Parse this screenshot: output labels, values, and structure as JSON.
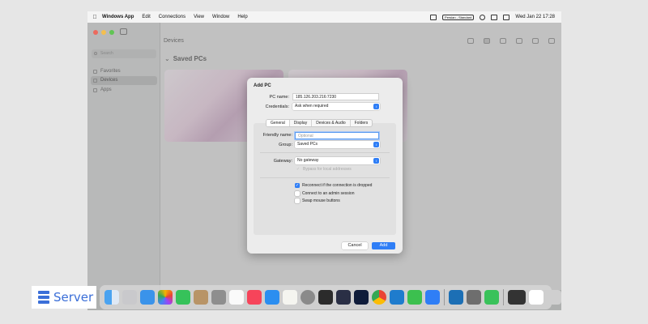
{
  "menubar": {
    "app_name": "Windows App",
    "items": [
      "Edit",
      "Connections",
      "View",
      "Window",
      "Help"
    ],
    "status_label": "Persian - Standard",
    "datetime": "Wed Jan 22  17:28"
  },
  "sidebar": {
    "search_placeholder": "Search",
    "items": [
      {
        "label": "Favorites",
        "icon": "star-icon"
      },
      {
        "label": "Devices",
        "icon": "monitor-icon"
      },
      {
        "label": "Apps",
        "icon": "apps-icon"
      }
    ]
  },
  "main": {
    "title": "Devices",
    "group_title": "Saved PCs"
  },
  "dialog": {
    "title": "Add PC",
    "pc_name_label": "PC name:",
    "pc_name_value": "185.126.203.216:7230",
    "credentials_label": "Credentials:",
    "credentials_value": "Ask when required",
    "tabs": [
      "General",
      "Display",
      "Devices & Audio",
      "Folders"
    ],
    "friendly_name_label": "Friendly name:",
    "friendly_name_placeholder": "Optional",
    "group_label": "Group:",
    "group_value": "Saved PCs",
    "gateway_label": "Gateway:",
    "gateway_value": "No gateway",
    "bypass_label": "Bypass for local addresses",
    "options": [
      {
        "label": "Reconnect if the connection is dropped",
        "checked": true
      },
      {
        "label": "Connect to an admin session",
        "checked": false
      },
      {
        "label": "Swap mouse buttons",
        "checked": false
      }
    ],
    "cancel_label": "Cancel",
    "add_label": "Add"
  },
  "colors": {
    "accent": "#2f7ef6",
    "logo": "#3b6fd8"
  },
  "dock_apps": [
    "finder",
    "launchpad",
    "safari",
    "photos",
    "facetime",
    "notes",
    "messages",
    "reminders",
    "music",
    "app-store",
    "preview",
    "system-settings",
    "terminal",
    "iina",
    "photoshop",
    "chrome",
    "vscode",
    "numbers",
    "windows-app",
    "migration",
    "calculator",
    "activity-monitor",
    "screenshot",
    "document",
    "trash"
  ],
  "logo": {
    "text": "Server"
  }
}
